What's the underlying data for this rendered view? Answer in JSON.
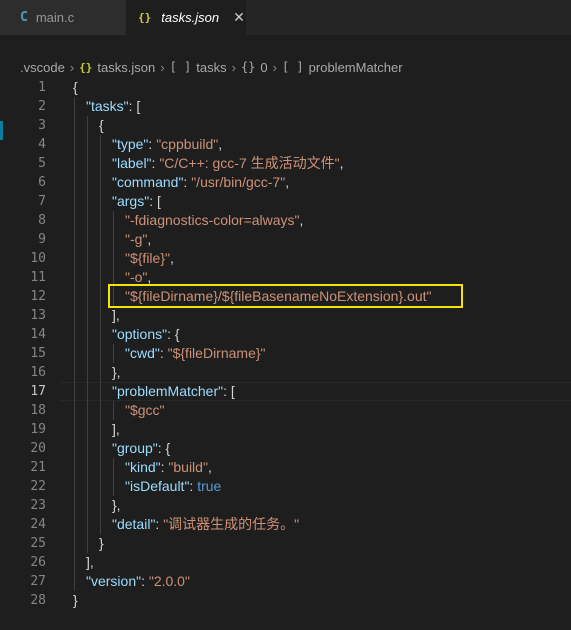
{
  "tabs": [
    {
      "icon": "C",
      "label": "main.c",
      "active": false
    },
    {
      "icon": "{}",
      "label": "tasks.json",
      "active": true,
      "close": "✕"
    }
  ],
  "breadcrumb": {
    "folder": ".vscode",
    "file_icon": "{}",
    "file": "tasks.json",
    "array_icon": "[ ]",
    "tasks": "tasks",
    "obj_icon": "{}",
    "index": "0",
    "array_icon2": "[ ]",
    "problemMatcher": "problemMatcher",
    "sep": "›"
  },
  "editor": {
    "current_line": 17,
    "lines": [
      {
        "n": "1",
        "indent": 0,
        "tokens": [
          {
            "t": "p",
            "v": "{"
          }
        ]
      },
      {
        "n": "2",
        "indent": 1,
        "tokens": [
          {
            "t": "k",
            "v": "\"tasks\""
          },
          {
            "t": "p",
            "v": ": ["
          }
        ]
      },
      {
        "n": "3",
        "indent": 2,
        "tokens": [
          {
            "t": "p",
            "v": "{"
          }
        ]
      },
      {
        "n": "4",
        "indent": 3,
        "tokens": [
          {
            "t": "k",
            "v": "\"type\""
          },
          {
            "t": "p",
            "v": ": "
          },
          {
            "t": "s",
            "v": "\"cppbuild\""
          },
          {
            "t": "p",
            "v": ","
          }
        ]
      },
      {
        "n": "5",
        "indent": 3,
        "tokens": [
          {
            "t": "k",
            "v": "\"label\""
          },
          {
            "t": "p",
            "v": ": "
          },
          {
            "t": "s",
            "v": "\"C/C++: gcc-7 生成活动文件\""
          },
          {
            "t": "p",
            "v": ","
          }
        ]
      },
      {
        "n": "6",
        "indent": 3,
        "tokens": [
          {
            "t": "k",
            "v": "\"command\""
          },
          {
            "t": "p",
            "v": ": "
          },
          {
            "t": "s",
            "v": "\"/usr/bin/gcc-7\""
          },
          {
            "t": "p",
            "v": ","
          }
        ]
      },
      {
        "n": "7",
        "indent": 3,
        "tokens": [
          {
            "t": "k",
            "v": "\"args\""
          },
          {
            "t": "p",
            "v": ": ["
          }
        ]
      },
      {
        "n": "8",
        "indent": 4,
        "tokens": [
          {
            "t": "s",
            "v": "\"-fdiagnostics-color=always\""
          },
          {
            "t": "p",
            "v": ","
          }
        ]
      },
      {
        "n": "9",
        "indent": 4,
        "tokens": [
          {
            "t": "s",
            "v": "\"-g\""
          },
          {
            "t": "p",
            "v": ","
          }
        ]
      },
      {
        "n": "10",
        "indent": 4,
        "tokens": [
          {
            "t": "s",
            "v": "\"${file}\""
          },
          {
            "t": "p",
            "v": ","
          }
        ]
      },
      {
        "n": "11",
        "indent": 4,
        "tokens": [
          {
            "t": "s",
            "v": "\"-o\""
          },
          {
            "t": "p",
            "v": ","
          }
        ]
      },
      {
        "n": "12",
        "indent": 4,
        "tokens": [
          {
            "t": "s",
            "v": "\"${fileDirname}/${fileBasenameNoExtension}.out\""
          }
        ]
      },
      {
        "n": "13",
        "indent": 3,
        "tokens": [
          {
            "t": "p",
            "v": "],"
          }
        ]
      },
      {
        "n": "14",
        "indent": 3,
        "tokens": [
          {
            "t": "k",
            "v": "\"options\""
          },
          {
            "t": "p",
            "v": ": {"
          }
        ]
      },
      {
        "n": "15",
        "indent": 4,
        "tokens": [
          {
            "t": "k",
            "v": "\"cwd\""
          },
          {
            "t": "p",
            "v": ": "
          },
          {
            "t": "s",
            "v": "\"${fileDirname}\""
          }
        ]
      },
      {
        "n": "16",
        "indent": 3,
        "tokens": [
          {
            "t": "p",
            "v": "},"
          }
        ]
      },
      {
        "n": "17",
        "indent": 3,
        "tokens": [
          {
            "t": "k",
            "v": "\"problemMatcher\""
          },
          {
            "t": "p",
            "v": ": ["
          }
        ]
      },
      {
        "n": "18",
        "indent": 4,
        "tokens": [
          {
            "t": "s",
            "v": "\"$gcc\""
          }
        ]
      },
      {
        "n": "19",
        "indent": 3,
        "tokens": [
          {
            "t": "p",
            "v": "],"
          }
        ]
      },
      {
        "n": "20",
        "indent": 3,
        "tokens": [
          {
            "t": "k",
            "v": "\"group\""
          },
          {
            "t": "p",
            "v": ": {"
          }
        ]
      },
      {
        "n": "21",
        "indent": 4,
        "tokens": [
          {
            "t": "k",
            "v": "\"kind\""
          },
          {
            "t": "p",
            "v": ": "
          },
          {
            "t": "s",
            "v": "\"build\""
          },
          {
            "t": "p",
            "v": ","
          }
        ]
      },
      {
        "n": "22",
        "indent": 4,
        "tokens": [
          {
            "t": "k",
            "v": "\"isDefault\""
          },
          {
            "t": "p",
            "v": ": "
          },
          {
            "t": "b",
            "v": "true"
          }
        ]
      },
      {
        "n": "23",
        "indent": 3,
        "tokens": [
          {
            "t": "p",
            "v": "},"
          }
        ]
      },
      {
        "n": "24",
        "indent": 3,
        "tokens": [
          {
            "t": "k",
            "v": "\"detail\""
          },
          {
            "t": "p",
            "v": ": "
          },
          {
            "t": "s",
            "v": "\"调试器生成的任务。\""
          }
        ]
      },
      {
        "n": "25",
        "indent": 2,
        "tokens": [
          {
            "t": "p",
            "v": "}"
          }
        ]
      },
      {
        "n": "26",
        "indent": 1,
        "tokens": [
          {
            "t": "p",
            "v": "],"
          }
        ]
      },
      {
        "n": "27",
        "indent": 1,
        "tokens": [
          {
            "t": "k",
            "v": "\"version\""
          },
          {
            "t": "p",
            "v": ": "
          },
          {
            "t": "s",
            "v": "\"2.0.0\""
          }
        ]
      },
      {
        "n": "28",
        "indent": 0,
        "tokens": [
          {
            "t": "p",
            "v": "}"
          }
        ]
      }
    ]
  },
  "colors": {
    "background": "#1e1e1e",
    "key": "#9cdcfe",
    "string": "#ce9178",
    "boolean": "#569cd6",
    "highlight_box": "#f2e600"
  }
}
